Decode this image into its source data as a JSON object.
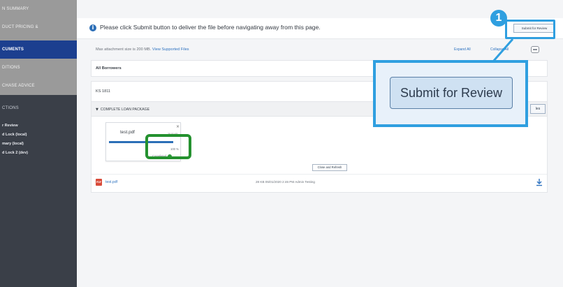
{
  "sidebar": {
    "items": [
      {
        "label": "N SUMMARY"
      },
      {
        "label": "DUCT PRICING &"
      },
      {
        "label": "CUMENTS"
      },
      {
        "label": "DITIONS"
      },
      {
        "label": "CHASE ADVICE"
      },
      {
        "label": "CTIONS"
      }
    ],
    "sub_items": [
      {
        "label": "r Review"
      },
      {
        "label": "d Lock (local)"
      },
      {
        "label": "mary (local)"
      },
      {
        "label": "d Lock 2 (dev)"
      }
    ]
  },
  "topbar": {
    "notice": "Please click Submit button to deliver the file before navigating away from this page.",
    "submit_label": "Submit for Review"
  },
  "attachments": {
    "max_text": "Max attachment size is 200 MB.",
    "supported_link": "View Supported Files",
    "expand_label": "Expand All",
    "collapse_label": "Collapse All"
  },
  "borrowers": {
    "label": "All Borrowers"
  },
  "docs": {
    "ks_label": "KS 1811",
    "package_label": "COMPLETE LOAN PACKAGE",
    "package_right_label": "les"
  },
  "upload_card": {
    "filename": "test.pdf",
    "size_text": "28.00 KB",
    "progress": 100,
    "progress_text": "100 %",
    "status": "Completed"
  },
  "close_refresh_label": "Close and Refresh",
  "file_row": {
    "name": "test.pdf",
    "meta": "28 KB   05/01/2020 2:46 PM   Admin Testing",
    "type_badge": "PDF"
  },
  "callout": {
    "badge_number": "1",
    "button_label": "Submit for Review"
  },
  "colors": {
    "sidebar_bg": "#3a3f48",
    "active_nav": "#1c3f8f",
    "callout_border": "#2f9fe0",
    "highlight_green": "#24912f",
    "link_blue": "#2f73c0"
  }
}
